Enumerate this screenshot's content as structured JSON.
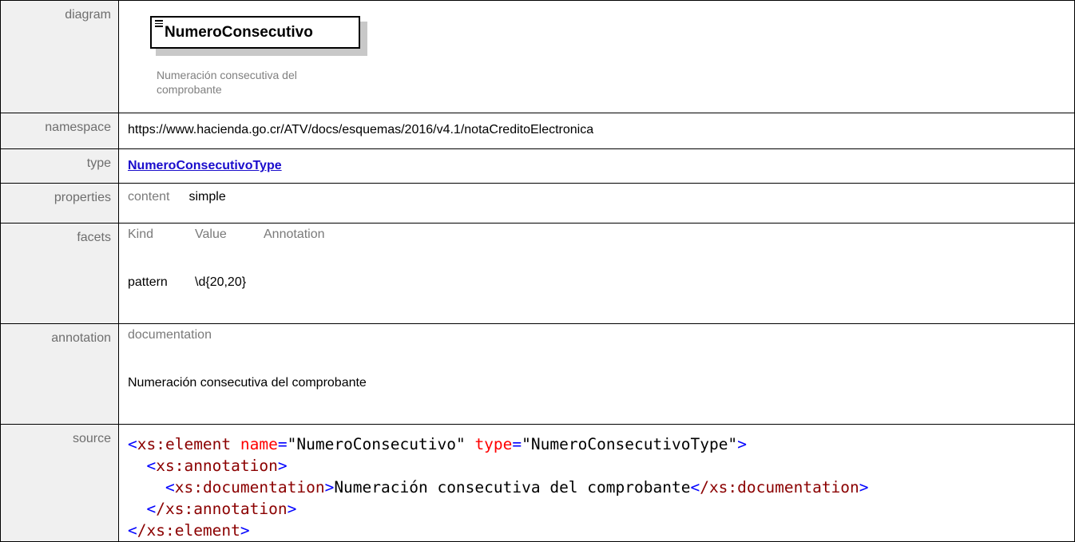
{
  "rows": {
    "diagram": {
      "label": "diagram",
      "element_name": "NumeroConsecutivo",
      "element_doc": "Numeración consecutiva del comprobante"
    },
    "namespace": {
      "label": "namespace",
      "value": "https://www.hacienda.go.cr/ATV/docs/esquemas/2016/v4.1/notaCreditoElectronica"
    },
    "type": {
      "label": "type",
      "value": "NumeroConsecutivoType"
    },
    "properties": {
      "label": "properties",
      "key": "content",
      "value": "simple"
    },
    "facets": {
      "label": "facets",
      "headers": [
        "Kind",
        "Value",
        "Annotation"
      ],
      "kind": "pattern",
      "value": "\\d{20,20}"
    },
    "annotation": {
      "label": "annotation",
      "header": "documentation",
      "value": "Numeración consecutiva del comprobante"
    },
    "source": {
      "label": "source",
      "tag_open": "xs:element",
      "attr1_name": "name",
      "attr1_value": "\"NumeroConsecutivo\"",
      "attr2_name": "type",
      "attr2_value": "\"NumeroConsecutivoType\"",
      "annotation_tag": "xs:annotation",
      "documentation_tag": "xs:documentation",
      "documentation_text": "Numeración consecutiva del comprobante",
      "close_annotation": "/xs:annotation",
      "close_element": "/xs:element"
    }
  }
}
